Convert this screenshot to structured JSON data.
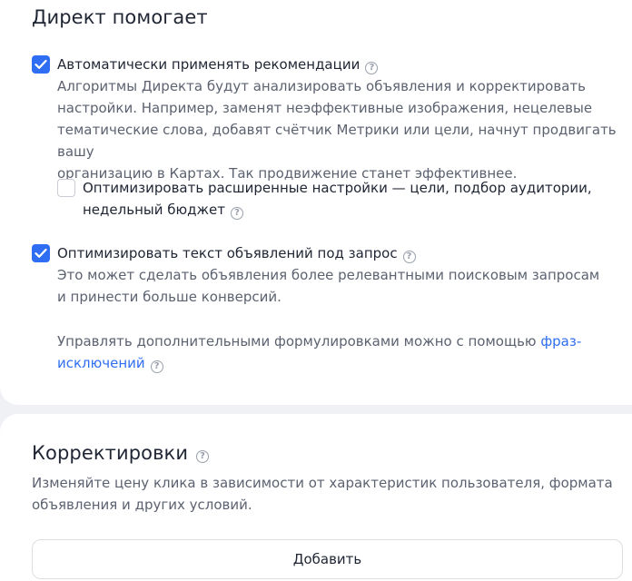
{
  "direct_helps": {
    "title": "Директ помогает",
    "auto_apply": {
      "label": "Автоматически применять рекомендации",
      "checked": true,
      "desc_lines": [
        "Алгоритмы Директа будут анализировать объявления и корректировать",
        "настройки. Например, заменят неэффективные изображения, нецелевые",
        "тематические слова, добавят счётчик Метрики или цели, начнут продвигать вашу",
        "организацию в Картах. Так продвижение станет эффективнее."
      ]
    },
    "optimize_advanced": {
      "label_line1": "Оптимизировать расширенные настройки — цели, подбор аудитории,",
      "label_line2": "недельный бюджет",
      "checked": false
    },
    "optimize_text": {
      "label": "Оптимизировать текст объявлений под запрос",
      "checked": true,
      "desc_lines": [
        "Это может сделать объявления более релевантными поисковым запросам",
        "и принести больше конверсий."
      ],
      "manage_text": "Управлять дополнительными формулировками можно с помощью",
      "link_part1": "фраз-",
      "link_part2": "исключений"
    }
  },
  "adjustments": {
    "title": "Корректировки",
    "desc_lines": [
      "Изменяйте цену клика в зависимости от характеристик пользователя, формата",
      "объявления и других условий."
    ],
    "add_button": "Добавить"
  },
  "colors": {
    "accent": "#2f6ef3",
    "page_bg": "#f0f1f4",
    "card_bg": "#ffffff",
    "text": "#1f2533",
    "muted_text": "#5c6270"
  },
  "icons": {
    "help": "question-circle-icon",
    "check": "checkmark-icon"
  }
}
